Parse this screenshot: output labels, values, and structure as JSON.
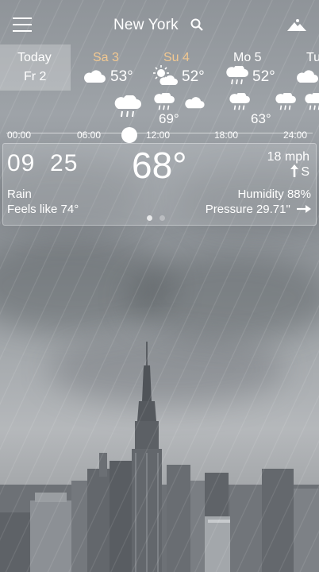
{
  "header": {
    "city": "New York"
  },
  "days": [
    {
      "name": "Today",
      "date": "Fr 2",
      "temp": "",
      "selected": true
    },
    {
      "name": "Sa 3",
      "temp": "53°",
      "icon": "cloud-icon",
      "weekend": true
    },
    {
      "name": "Su 4",
      "temp": "52°",
      "icon": "sun-cloud-icon",
      "weekend": true
    },
    {
      "name": "Mo 5",
      "temp": "52°",
      "icon": "rain-cloud-icon"
    },
    {
      "name": "Tu",
      "temp": "",
      "icon": "cloud-icon"
    }
  ],
  "hourly": {
    "temps": [
      "69°",
      "63°"
    ],
    "icons": [
      "rain-cloud-icon",
      "rain-cloud-icon",
      "cloud-icon",
      "rain-cloud-icon",
      "rain-cloud-icon",
      "rain-cloud-icon"
    ],
    "times": [
      "00:00",
      "06:00",
      "12:00",
      "18:00",
      "24:00"
    ]
  },
  "current": {
    "time_hh": "09",
    "time_mm": "25",
    "temperature": "68°",
    "wind_speed": "18 mph",
    "wind_dir": "S",
    "condition": "Rain",
    "feels_like": "Feels like 74°",
    "humidity": "Humidity 88%",
    "pressure": "Pressure 29.71\""
  },
  "colors": {
    "weekend": "#f2c891",
    "text": "#ffffff"
  }
}
